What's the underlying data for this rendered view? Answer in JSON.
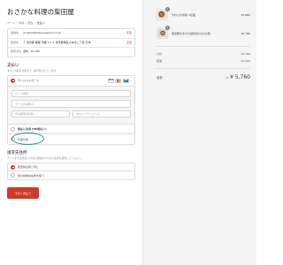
{
  "store": {
    "title": "おさかな料理の柴田屋"
  },
  "breadcrumb": [
    "カート",
    "情報",
    "配送",
    "支払い"
  ],
  "info": [
    {
      "key": "連絡先",
      "value": "dr.kada@kaasuyaeiyou.co.jp",
      "change": "変更"
    },
    {
      "key": "配送先",
      "value": "〒 東京都 都都 東都 1-1-1 東京都港区六本木二丁目 日本",
      "change": "変更"
    },
    {
      "key": "配送方法",
      "value": "送料 · ¥1,000",
      "change": ""
    }
  ],
  "payment": {
    "title": "支払い",
    "subtitle": "すべての取引は安全で、暗号化されています。",
    "method_label": "クレジットカード",
    "more_label": "+",
    "fields": {
      "card_number": "カード番号",
      "card_name": "カードの名義人",
      "expiry": "有効期限(月/年)",
      "cvc": "セキュリティコード"
    },
    "options": [
      "後払い決済 (NP後払い)",
      "代金引換"
    ]
  },
  "billing": {
    "title": "請求先住所",
    "subtitle": "カードまたは支払い方法に関連付けられた住所を選択してください。",
    "options": [
      "配送先住所と同じ",
      "別の請求先住所を使う"
    ]
  },
  "pay_button": "今すぐ支払う",
  "summary": {
    "items": [
      {
        "qty": "1",
        "name": "やわらか煮魚 4点盛",
        "price": "¥1,880"
      },
      {
        "qty": "1",
        "name": "柴田屋おまかせ詰め合わせ(冷凍)",
        "price": "¥2,780"
      }
    ],
    "subtotal_label": "小計",
    "subtotal": "¥4,760",
    "shipping_label": "配送",
    "shipping": "¥1,000",
    "total_label": "合計",
    "currency": "JPY",
    "total": "¥ 5,760"
  },
  "colors": {
    "accent": "#d13a25",
    "highlight": "#1b9a93"
  }
}
